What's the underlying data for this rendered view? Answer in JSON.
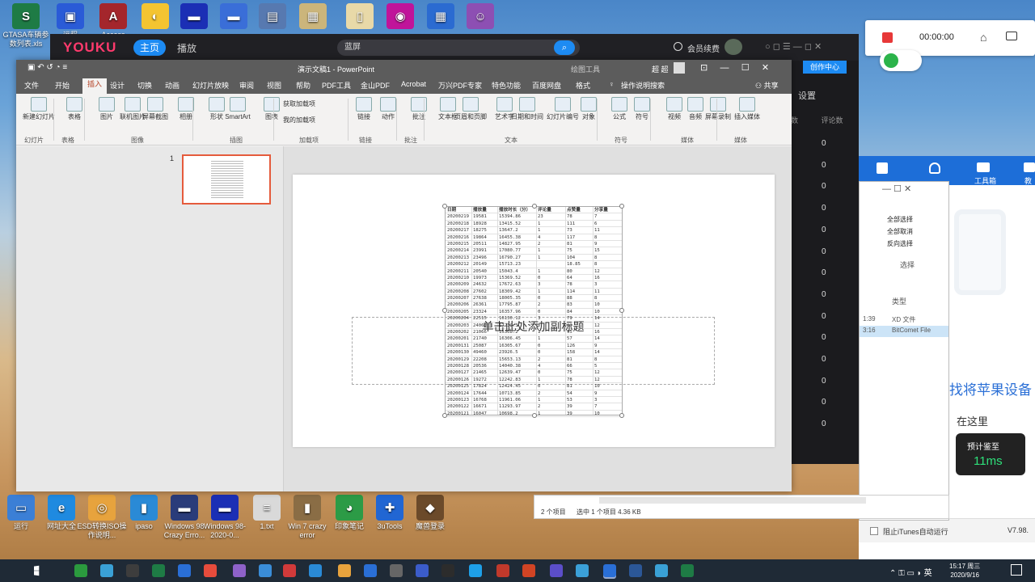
{
  "desktop": {
    "top_icons": [
      {
        "label": "GTASA车辆参数列表.xls",
        "glyph": "S",
        "color": "#1e7b45"
      },
      {
        "label": "远程",
        "glyph": "▣",
        "color": "#2a5bd7"
      },
      {
        "label": "Access",
        "glyph": "A",
        "color": "#a4262c"
      },
      {
        "label": "",
        "glyph": "◐",
        "color": "#f4c431"
      },
      {
        "label": "",
        "glyph": "▬",
        "color": "#1b2fb5"
      },
      {
        "label": "",
        "glyph": "▬",
        "color": "#3a6ed8"
      },
      {
        "label": "",
        "glyph": "▤",
        "color": "#5779b0"
      },
      {
        "label": "",
        "glyph": "▦",
        "color": "#cbb57b"
      },
      {
        "label": "",
        "glyph": "▯",
        "color": "#e8d9a8"
      },
      {
        "label": "",
        "glyph": "◉",
        "color": "#c0149a"
      },
      {
        "label": "",
        "glyph": "▦",
        "color": "#2b6bd1"
      },
      {
        "label": "",
        "glyph": "☺",
        "color": "#8d4fb3"
      }
    ],
    "bottom_icons": [
      {
        "label": "运行",
        "glyph": "▭",
        "color": "#3b7fd6"
      },
      {
        "label": "网址大全",
        "glyph": "e",
        "color": "#1f8ae0"
      },
      {
        "label": "ESD转换ISO操作说明...",
        "glyph": "◎",
        "color": "#e7a33d"
      },
      {
        "label": "ipaso",
        "glyph": "▮",
        "color": "#2a8ad6"
      },
      {
        "label": "Windows 98 Crazy Erro...",
        "glyph": "▬",
        "color": "#2a3c7a"
      },
      {
        "label": "Windows 98-2020-0...",
        "glyph": "▬",
        "color": "#1b2fb5"
      },
      {
        "label": "1.txt",
        "glyph": "≡",
        "color": "#d9d9d9"
      },
      {
        "label": "Win 7 crazy error",
        "glyph": "▮",
        "color": "#8a6d45"
      },
      {
        "label": "印象笔记",
        "glyph": "◕",
        "color": "#2c9b46"
      },
      {
        "label": "3uTools",
        "glyph": "✚",
        "color": "#2166d3"
      },
      {
        "label": "魔兽登录",
        "glyph": "◆",
        "color": "#6b4a2a"
      }
    ]
  },
  "youku": {
    "logo": "YOUKU",
    "home": "主页",
    "play": "播放",
    "search_value": "蓝屏",
    "vip": "会员续费",
    "creator": "创作中心",
    "settings": "设置",
    "col_headers": [
      "数",
      "评论数"
    ],
    "comment_counts": [
      "0",
      "0",
      "0",
      "0",
      "0",
      "0",
      "0",
      "0",
      "0",
      "0",
      "0",
      "0",
      "0",
      "0"
    ]
  },
  "itunes": {
    "menu": [
      "工具箱",
      "教程"
    ],
    "promo": "找将苹果设备",
    "here": "在这里",
    "speed_label": "预计鉴至",
    "speed_value": "11ms",
    "prevent_sync": "阻止iTunes自动运行",
    "version": "V7.98."
  },
  "explorer": {
    "opts": [
      "全部选择",
      "全部取消",
      "反向选择"
    ],
    "select_group": "选择",
    "type_header": "类型",
    "types": [
      "XD 文件",
      "BitComet File"
    ],
    "times": [
      "1:39",
      "3:16"
    ],
    "status": "2 个项目",
    "status_selected": "选中 1 个项目 4.36 KB"
  },
  "recorder": {
    "time": "00:00:00"
  },
  "ppt": {
    "doc_title": "演示文稿1 - PowerPoint",
    "context_tab": "绘图工具",
    "user": "超 超",
    "menu": [
      "文件",
      "开始",
      "插入",
      "设计",
      "切换",
      "动画",
      "幻灯片放映",
      "审阅",
      "视图",
      "帮助",
      "PDF工具",
      "金山PDF",
      "Acrobat",
      "万兴PDF专家",
      "特色功能",
      "百度网盘",
      "格式"
    ],
    "tell": "操作说明搜索",
    "share": "共享",
    "ribbon_buttons": [
      "新建幻灯片",
      "表格",
      "图片",
      "联机图片",
      "屏幕截图",
      "相册",
      "形状",
      "SmartArt",
      "图表",
      "获取加载项",
      "我的加载项",
      "链接",
      "动作",
      "批注",
      "文本框",
      "页眉和页脚",
      "艺术字",
      "日期和时间",
      "幻灯片编号",
      "对象",
      "公式",
      "符号",
      "视频",
      "音频",
      "屏幕录制",
      "插入媒体"
    ],
    "ribbon_groups": [
      "幻灯片",
      "表格",
      "图像",
      "插图",
      "加载项",
      "链接",
      "批注",
      "文本",
      "符号",
      "媒体",
      "媒体"
    ],
    "slide_number": "1",
    "subtitle_placeholder": "单击此处添加副标题",
    "table_headers": [
      "日期",
      "播放量",
      "播放时长（分）",
      "评论量",
      "点赞量",
      "分享量"
    ],
    "table_rows": [
      [
        "20200219",
        "19581",
        "15394.86",
        "23",
        "78",
        "7"
      ],
      [
        "20200218",
        "18928",
        "13415.52",
        "1",
        "111",
        "6"
      ],
      [
        "20200217",
        "18275",
        "13647.2",
        "1",
        "73",
        "11"
      ],
      [
        "20200216",
        "19864",
        "16455.38",
        "4",
        "117",
        "8"
      ],
      [
        "20200215",
        "20511",
        "14827.95",
        "2",
        "81",
        "9"
      ],
      [
        "20200214",
        "23991",
        "17080.77",
        "1",
        "75",
        "15"
      ],
      [
        "20200213",
        "23496",
        "16790.27",
        "1",
        "104",
        "8"
      ],
      [
        "20200212",
        "20149",
        "15713.23",
        "",
        "18.85",
        "8"
      ],
      [
        "20200211",
        "20540",
        "15043.4",
        "1",
        "80",
        "12"
      ],
      [
        "20200210",
        "19973",
        "15369.52",
        "0",
        "64",
        "16"
      ],
      [
        "20200209",
        "24632",
        "17672.63",
        "3",
        "78",
        "3"
      ],
      [
        "20200208",
        "27602",
        "18309.42",
        "1",
        "114",
        "11"
      ],
      [
        "20200207",
        "27638",
        "18005.35",
        "0",
        "88",
        "8"
      ],
      [
        "20200206",
        "26361",
        "17795.87",
        "2",
        "83",
        "10"
      ],
      [
        "20200205",
        "23324",
        "16357.96",
        "0",
        "84",
        "10"
      ],
      [
        "20200204",
        "22515",
        "16130.12",
        "3",
        "79",
        "14"
      ],
      [
        "20200203",
        "24060",
        "17232.5",
        "0",
        "83",
        "12"
      ],
      [
        "20200202",
        "21066",
        "15308.2",
        "1",
        "95",
        "16"
      ],
      [
        "20200201",
        "21740",
        "16306.45",
        "1",
        "57",
        "14"
      ],
      [
        "20200131",
        "25087",
        "16305.67",
        "0",
        "126",
        "9"
      ],
      [
        "20200130",
        "49460",
        "23926.5",
        "0",
        "158",
        "14"
      ],
      [
        "20200129",
        "22208",
        "15653.13",
        "2",
        "81",
        "8"
      ],
      [
        "20200128",
        "20536",
        "14040.38",
        "4",
        "66",
        "5"
      ],
      [
        "20200127",
        "21465",
        "12639.47",
        "0",
        "75",
        "12"
      ],
      [
        "20200126",
        "19272",
        "12242.83",
        "1",
        "78",
        "12"
      ],
      [
        "20200125",
        "17824",
        "12424.45",
        "0",
        "81",
        "10"
      ],
      [
        "20200124",
        "17644",
        "10713.85",
        "2",
        "54",
        "9"
      ],
      [
        "20200123",
        "16768",
        "11961.06",
        "1",
        "53",
        "3"
      ],
      [
        "20200122",
        "16671",
        "11293.97",
        "2",
        "39",
        "7"
      ],
      [
        "20200121",
        "16047",
        "10698.2",
        "1",
        "39",
        "10"
      ]
    ]
  },
  "taskbar": {
    "time": "15:17 周三",
    "date": "2020/9/16"
  }
}
